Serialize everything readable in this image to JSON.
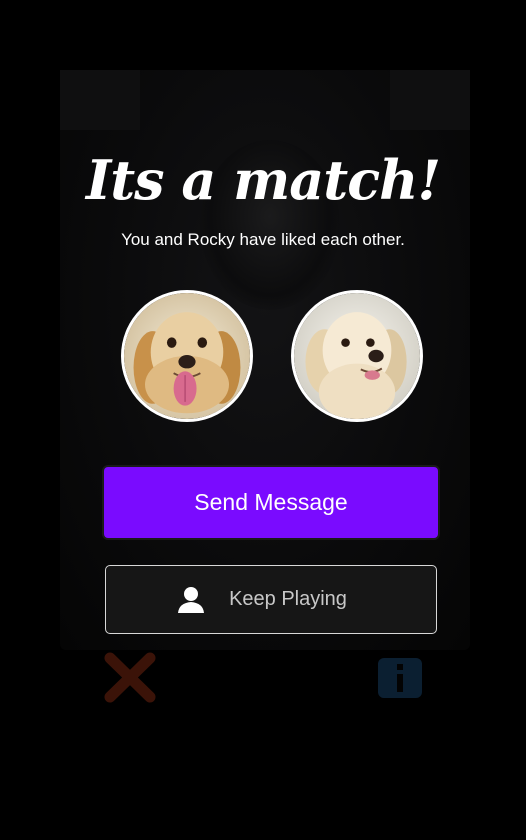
{
  "match": {
    "title": "Its a match!",
    "subtitle": "You and Rocky have liked each other."
  },
  "avatars": {
    "left": "golden-retriever-photo",
    "right": "cream-retriever-photo"
  },
  "actions": {
    "send_message_label": "Send Message",
    "keep_playing_label": "Keep Playing",
    "keep_playing_icon": "person-icon"
  },
  "background": {
    "dislike_icon": "close-icon",
    "info_icon": "info-icon"
  },
  "colors": {
    "accent": "#7a0bff",
    "background": "#000000",
    "secondary_button": "#161616",
    "secondary_border": "#d8d8d8"
  }
}
